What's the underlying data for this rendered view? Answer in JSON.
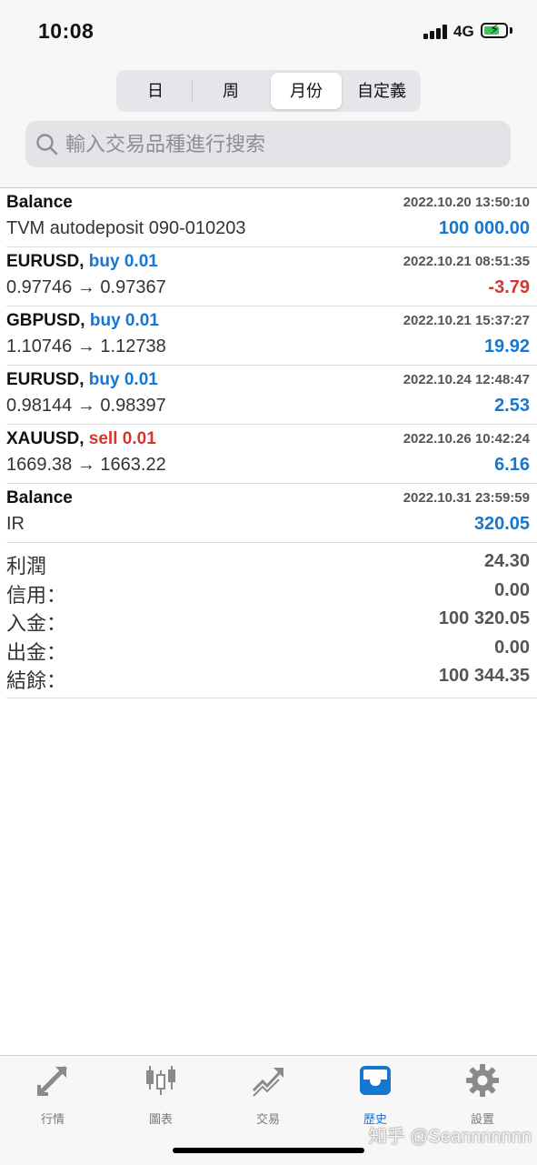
{
  "status_bar": {
    "time": "10:08",
    "network": "4G",
    "battery_charging": true
  },
  "period_tabs": [
    {
      "label": "日",
      "active": false
    },
    {
      "label": "周",
      "active": false
    },
    {
      "label": "月份",
      "active": true
    },
    {
      "label": "自定義",
      "active": false
    }
  ],
  "search": {
    "placeholder": "輸入交易品種進行搜索",
    "icon": "search-icon"
  },
  "records": [
    {
      "symbol": "Balance",
      "side": "",
      "volume": "",
      "description": "TVM autodeposit 090-010203",
      "datetime": "2022.10.20 13:50:10",
      "amount": "100 000.00"
    },
    {
      "symbol": "EURUSD,",
      "side": "buy",
      "volume": "0.01",
      "description": "0.97746 → 0.97367",
      "datetime": "2022.10.21 08:51:35",
      "amount": "-3.79"
    },
    {
      "symbol": "GBPUSD,",
      "side": "buy",
      "volume": "0.01",
      "description": "1.10746 → 1.12738",
      "datetime": "2022.10.21 15:37:27",
      "amount": "19.92"
    },
    {
      "symbol": "EURUSD,",
      "side": "buy",
      "volume": "0.01",
      "description": "0.98144 → 0.98397",
      "datetime": "2022.10.24 12:48:47",
      "amount": "2.53"
    },
    {
      "symbol": "XAUUSD,",
      "side": "sell",
      "volume": "0.01",
      "description": "1669.38 → 1663.22",
      "datetime": "2022.10.26 10:42:24",
      "amount": "6.16"
    },
    {
      "symbol": "Balance",
      "side": "",
      "volume": "",
      "description": "IR",
      "datetime": "2022.10.31 23:59:59",
      "amount": "320.05"
    }
  ],
  "summary": [
    {
      "label": "利潤",
      "value": "24.30"
    },
    {
      "label": "信用：",
      "value": "0.00"
    },
    {
      "label": "入金：",
      "value": "100 320.05"
    },
    {
      "label": "出金：",
      "value": "0.00"
    },
    {
      "label": "結餘：",
      "value": "100 344.35"
    }
  ],
  "tab_bar": [
    {
      "label": "行情",
      "icon": "quotes-arrows-icon",
      "active": false
    },
    {
      "label": "圖表",
      "icon": "candlestick-chart-icon",
      "active": false
    },
    {
      "label": "交易",
      "icon": "trade-trend-icon",
      "active": false
    },
    {
      "label": "歷史",
      "icon": "inbox-history-icon",
      "active": true
    },
    {
      "label": "設置",
      "icon": "gear-icon",
      "active": false
    }
  ],
  "watermark": "知乎 @Seannnnnnn",
  "colors": {
    "accent": "#1677d2",
    "negative": "#d9362b",
    "battery": "#34c759"
  }
}
